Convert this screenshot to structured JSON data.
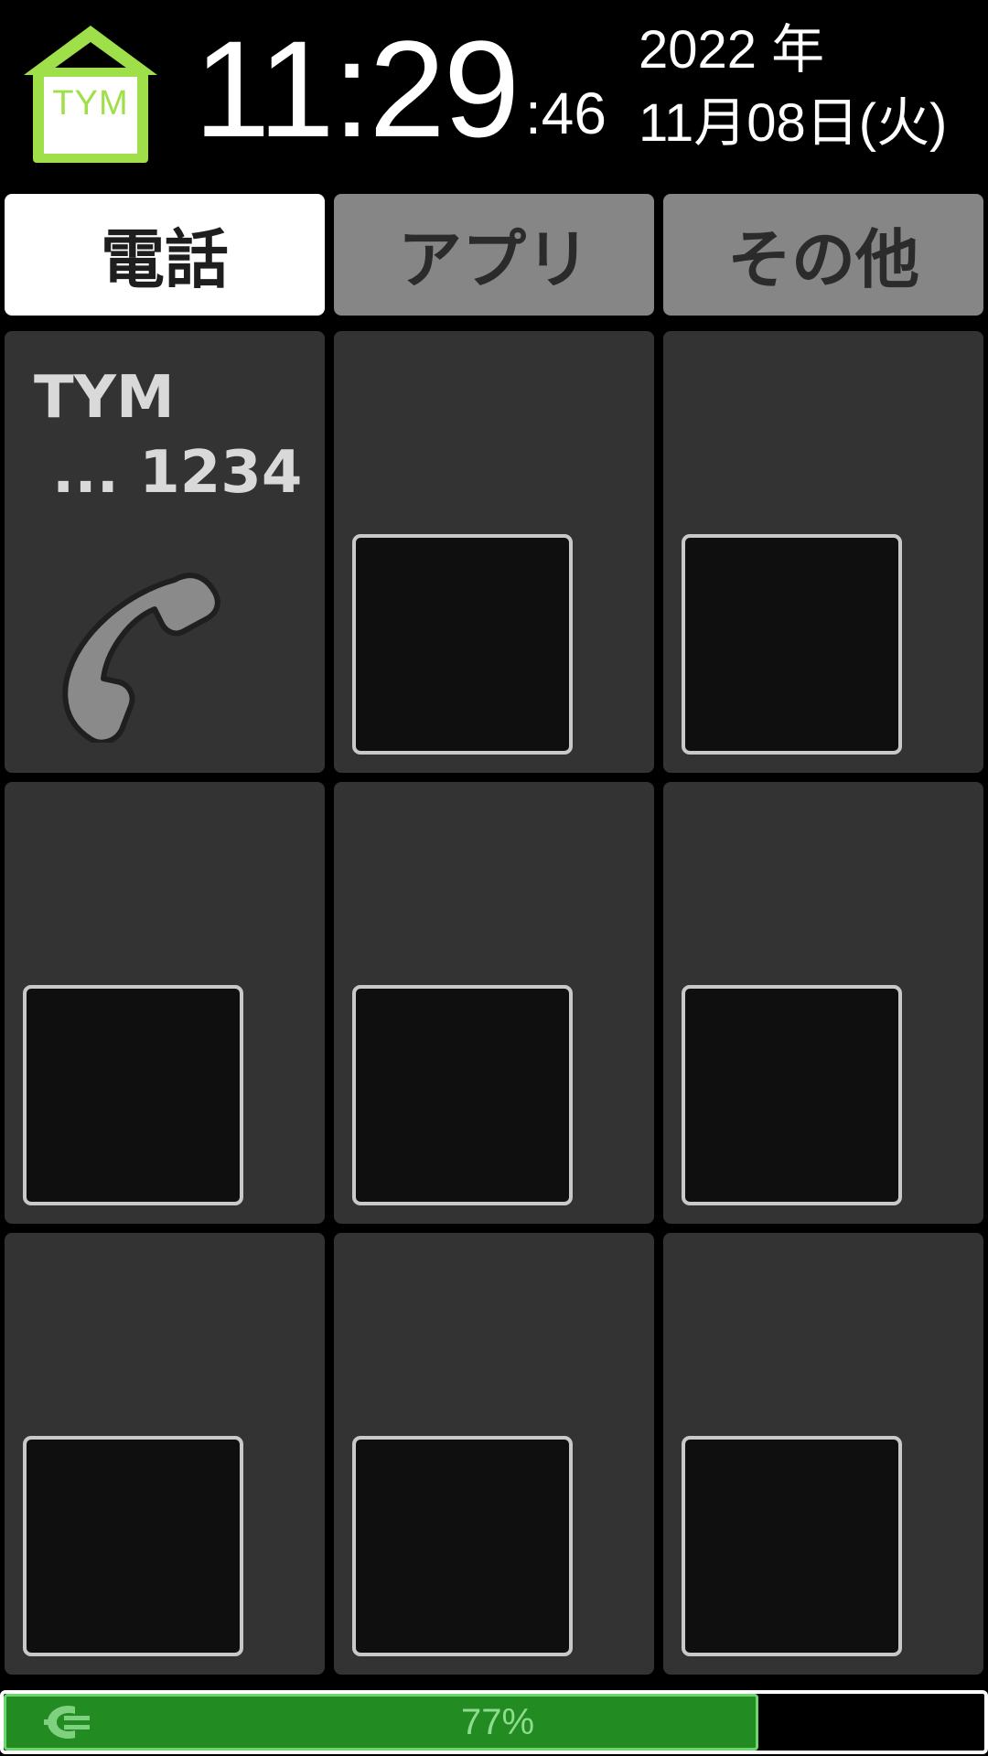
{
  "header": {
    "logo_text": "TYM",
    "time_hm": "11:29",
    "time_sec": ":46",
    "date_year": "2022 年",
    "date_day": "11月08日(火)"
  },
  "tabs": [
    {
      "label": "電話",
      "active": true
    },
    {
      "label": "アプリ",
      "active": false
    },
    {
      "label": "その他",
      "active": false
    }
  ],
  "grid": {
    "contact": {
      "name": "TYM",
      "number": "... 1234",
      "icon": "phone-handset-icon"
    }
  },
  "battery": {
    "level_percent": 77,
    "label": "77%",
    "icon": "charging-plug-icon"
  },
  "colors": {
    "logo": "#9fe04a",
    "battery_fill": "#228b22",
    "battery_border": "#6fd56f",
    "cell_bg": "#333333",
    "tab_inactive": "#868686"
  }
}
